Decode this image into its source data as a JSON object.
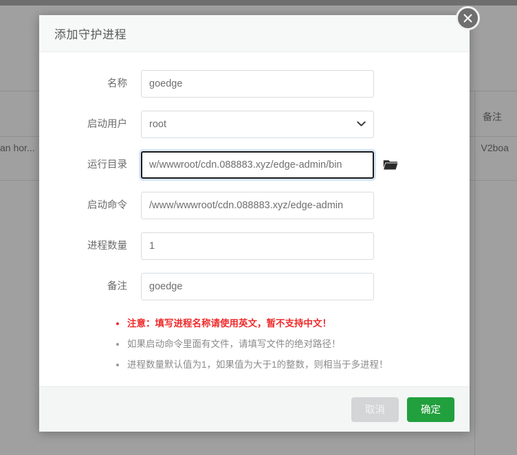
{
  "background": {
    "column_header_remark": "备注",
    "cell_left_truncated": "an hor...",
    "cell_right_truncated": "V2boa"
  },
  "modal": {
    "title": "添加守护进程",
    "close_icon": "close-icon",
    "form": [
      {
        "label": "名称",
        "type": "text",
        "value": "goedge",
        "placeholder": "",
        "focused": false
      },
      {
        "label": "启动用户",
        "type": "select",
        "value": "root",
        "placeholder": "",
        "focused": false,
        "options": [
          "root"
        ],
        "chevron_icon": "chevron-down-icon"
      },
      {
        "label": "运行目录",
        "type": "text",
        "value": "w/wwwroot/cdn.088883.xyz/edge-admin/bin",
        "placeholder": "",
        "focused": true,
        "folder_icon": "folder-icon"
      },
      {
        "label": "启动命令",
        "type": "text",
        "value": "/www/wwwroot/cdn.088883.xyz/edge-admin",
        "placeholder": "",
        "focused": false
      },
      {
        "label": "进程数量",
        "type": "text",
        "value": "1",
        "placeholder": "",
        "focused": false
      },
      {
        "label": "备注",
        "type": "text",
        "value": "goedge",
        "placeholder": "",
        "focused": false
      }
    ],
    "notes": [
      {
        "text": "注意：填写进程名称请使用英文，暂不支持中文！",
        "warning": true
      },
      {
        "text": "如果启动命令里面有文件，请填写文件的绝对路径！",
        "warning": false
      },
      {
        "text": "进程数量默认值为1，如果值为大于1的整数，则相当于多进程！",
        "warning": false
      }
    ],
    "footer": {
      "cancel_label": "取消",
      "confirm_label": "确定"
    }
  },
  "colors": {
    "confirm_green": "#21a03d",
    "cancel_gray": "#d3d5d6",
    "warning_red": "#ef2b2b",
    "modal_header_bg": "#f7f8f8",
    "modal_footer_bg": "#f4f6f6",
    "backdrop": "#a0a0a0"
  }
}
